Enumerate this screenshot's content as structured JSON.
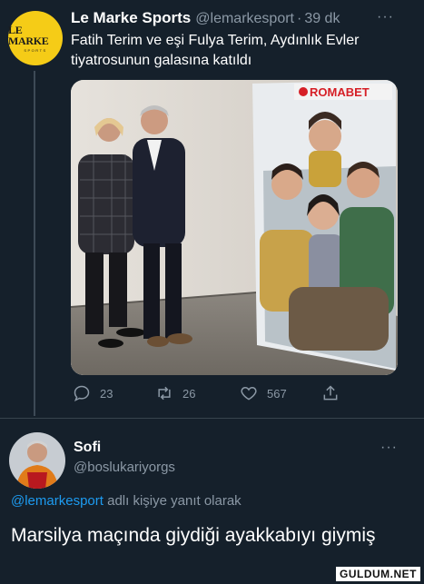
{
  "tweet": {
    "avatar_logo": "LE MARKE",
    "avatar_sub": "SPORTS",
    "name": "Le Marke Sports",
    "handle": "@lemarkesport",
    "separator": "·",
    "time": "39 dk",
    "more": "···",
    "text": "Fatih Terim ve eşi Fulya Terim, Aydınlık Evler tiyatrosunun galasına katıldı",
    "poster_brand": "ROMABET",
    "actions": {
      "replies": "23",
      "retweets": "26",
      "likes": "567"
    }
  },
  "reply": {
    "name": "Sofi",
    "handle": "@boslukariyorgs",
    "more": "···",
    "reply_to_mention": "@lemarkesport",
    "reply_to_suffix": " adlı kişiye yanıt olarak",
    "text": "Marsilya maçında giydiği ayakkabıyı giymiş"
  },
  "watermark": "GULDUM.NET",
  "colors": {
    "background": "#15202b",
    "secondary_text": "#8b98a5",
    "link": "#1d9bf0",
    "avatar_yellow": "#f5cc17"
  }
}
